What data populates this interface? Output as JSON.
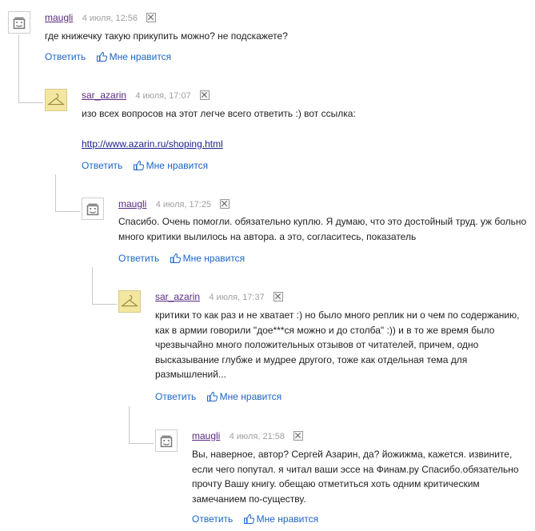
{
  "actions": {
    "reply": "Ответить",
    "like": "Мне нравится"
  },
  "comments": [
    {
      "author": "maugli",
      "time": "4 июля, 12:56",
      "avatar": "robot-icon",
      "lines": [
        "где книжечку такую прикупить можно? не подскажете?"
      ]
    },
    {
      "author": "sar_azarin",
      "time": "4 июля, 17:07",
      "avatar": "hanger-photo",
      "lines": [
        "изо всех вопросов на этот легче всего ответить :) вот ссылка:"
      ],
      "link": "http://www.azarin.ru/shoping.html"
    },
    {
      "author": "maugli",
      "time": "4 июля, 17:25",
      "avatar": "robot-icon",
      "lines": [
        "Спасибо. Очень помогли. обязательно куплю. Я думаю, что это достойный труд. уж больно",
        "много критики вылилось на автора. а это, согласитесь, показатель"
      ]
    },
    {
      "author": "sar_azarin",
      "time": "4 июля, 17:37",
      "avatar": "hanger-photo",
      "lines": [
        "критики то как раз и не хватает :) но было много реплик ни о чем по содержанию,",
        "как в армии говорили \"дое***ся можно и до столба\" :)) и в то же время было",
        "чрезвычайно много положительных отзывов от читателей, причем, одно",
        "высказывание глубже и мудрее другого, тоже как отдельная тема для",
        "размышлений..."
      ]
    },
    {
      "author": "maugli",
      "time": "4 июля, 21:58",
      "avatar": "robot-icon",
      "lines": [
        "Вы, наверное, автор? Сергей Азарин, да? йожижма, кажется. извините,",
        "если чего попутал. я читал ваши эссе на Финам.ру Спасибо.обязательно",
        "прочту Вашу книгу. обещаю отметиться хоть одним критическим",
        "замечанием по-существу."
      ]
    }
  ],
  "colors": {
    "author": "#5a2a82",
    "action": "#1d64c7",
    "time": "#a0a0a0",
    "line": "#c8c8c8"
  }
}
